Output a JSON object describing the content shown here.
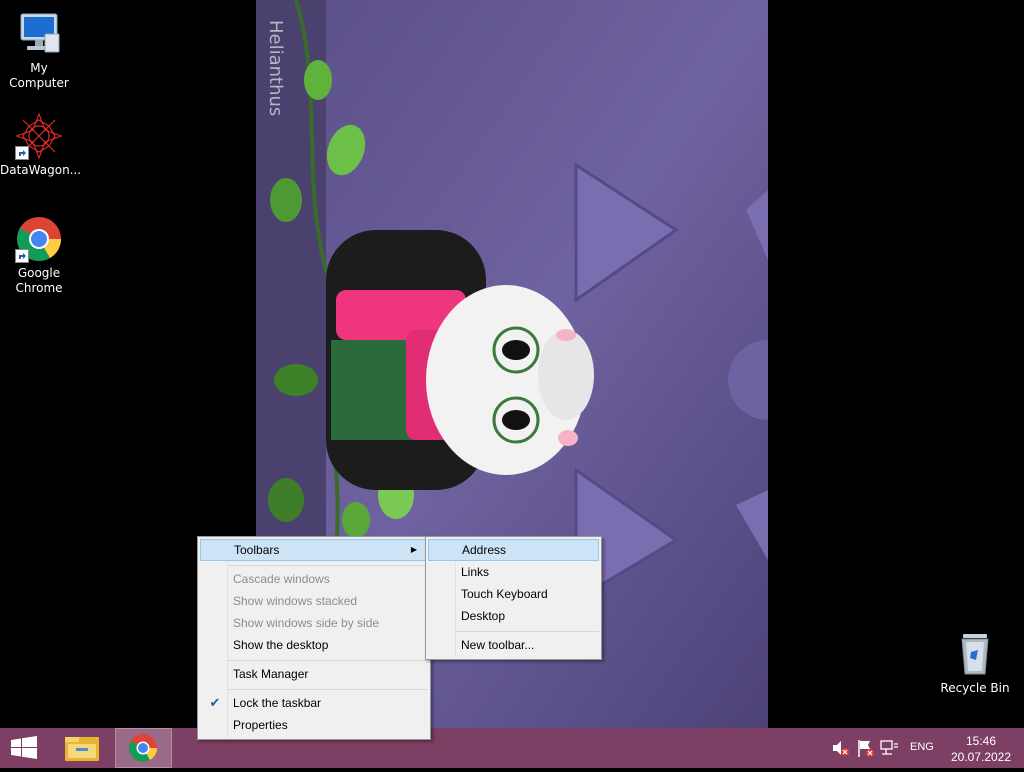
{
  "desktop": {
    "icons": [
      {
        "label": "My Computer",
        "icon": "computer-icon"
      },
      {
        "label": "DataWagon...",
        "icon": "datawagon-icon"
      },
      {
        "label": "Google Chrome",
        "icon": "chrome-icon"
      },
      {
        "label": "Recycle Bin",
        "icon": "recycle-bin-icon"
      }
    ],
    "wallpaper_text": "Helianthus"
  },
  "context_menu": {
    "items": [
      {
        "label": "Toolbars",
        "enabled": true,
        "submenu": true
      },
      {
        "label": "Cascade windows",
        "enabled": false
      },
      {
        "label": "Show windows stacked",
        "enabled": false
      },
      {
        "label": "Show windows side by side",
        "enabled": false
      },
      {
        "label": "Show the desktop",
        "enabled": true
      },
      {
        "label": "Task Manager",
        "enabled": true
      },
      {
        "label": "Lock the taskbar",
        "enabled": true,
        "checked": true
      },
      {
        "label": "Properties",
        "enabled": true
      }
    ]
  },
  "toolbars_submenu": {
    "items": [
      {
        "label": "Address",
        "highlighted": true
      },
      {
        "label": "Links"
      },
      {
        "label": "Touch Keyboard"
      },
      {
        "label": "Desktop"
      },
      {
        "label": "New toolbar..."
      }
    ]
  },
  "taskbar": {
    "color": "#7d3f63",
    "buttons": [
      "start-icon",
      "file-explorer-icon",
      "chrome-icon"
    ],
    "tray": {
      "language": "ENG",
      "time": "15:46",
      "date": "20.07.2022"
    }
  }
}
